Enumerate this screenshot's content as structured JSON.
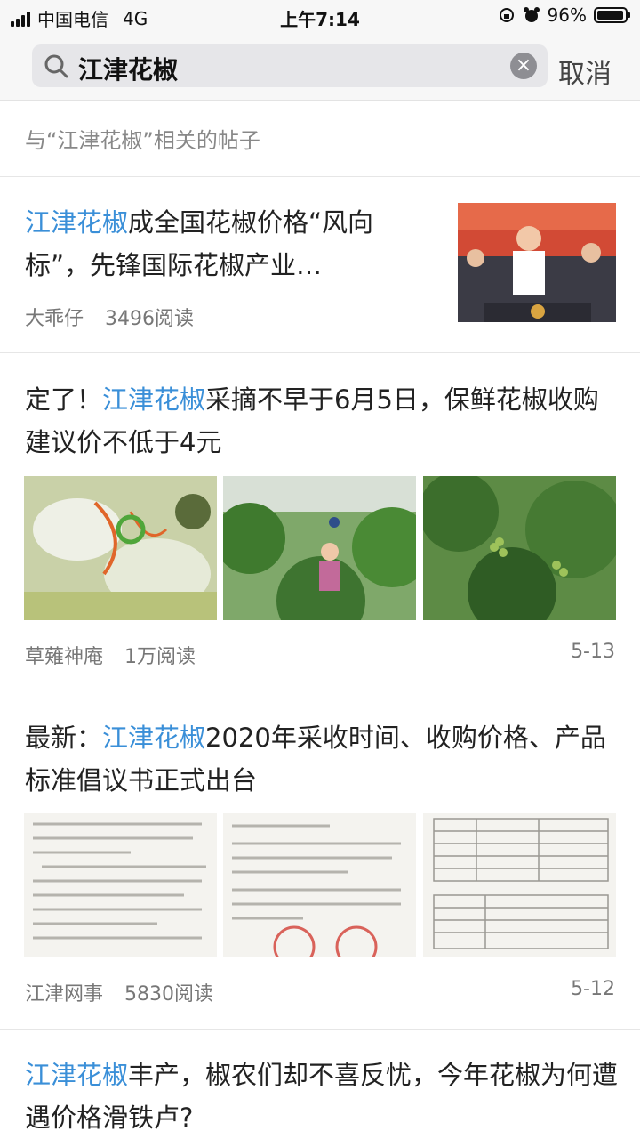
{
  "status": {
    "carrier": "中国电信",
    "network": "4G",
    "time": "上午7:14",
    "battery": "96%",
    "battery_level": 0.96
  },
  "search": {
    "query": "江津花椒",
    "cancel_label": "取消"
  },
  "section_label": "与“江津花椒”相关的帖子",
  "posts": [
    {
      "title_hl": "江津花椒",
      "title_rest": "成全国花椒价格“风向标”，先锋国际花椒产业…",
      "author": "大乖仔",
      "reads": "3496阅读",
      "date": ""
    },
    {
      "title_pre": "定了！",
      "title_hl": "江津花椒",
      "title_rest": "采摘不早于6月5日，保鲜花椒收购建议价不低于4元",
      "author": "草薙神庵",
      "reads": "1万阅读",
      "date": "5-13"
    },
    {
      "title_pre": "最新：",
      "title_hl": "江津花椒",
      "title_rest": "2020年采收时间、收购价格、产品标准倡议书正式出台",
      "author": "江津网事",
      "reads": "5830阅读",
      "date": "5-12"
    },
    {
      "title_hl": "江津花椒",
      "title_rest": "丰产，椒农们却不喜反忧，今年花椒为何遭遇价格滑铁卢?"
    }
  ],
  "colors": {
    "highlight": "#3a8fd8",
    "meta": "#777777"
  }
}
